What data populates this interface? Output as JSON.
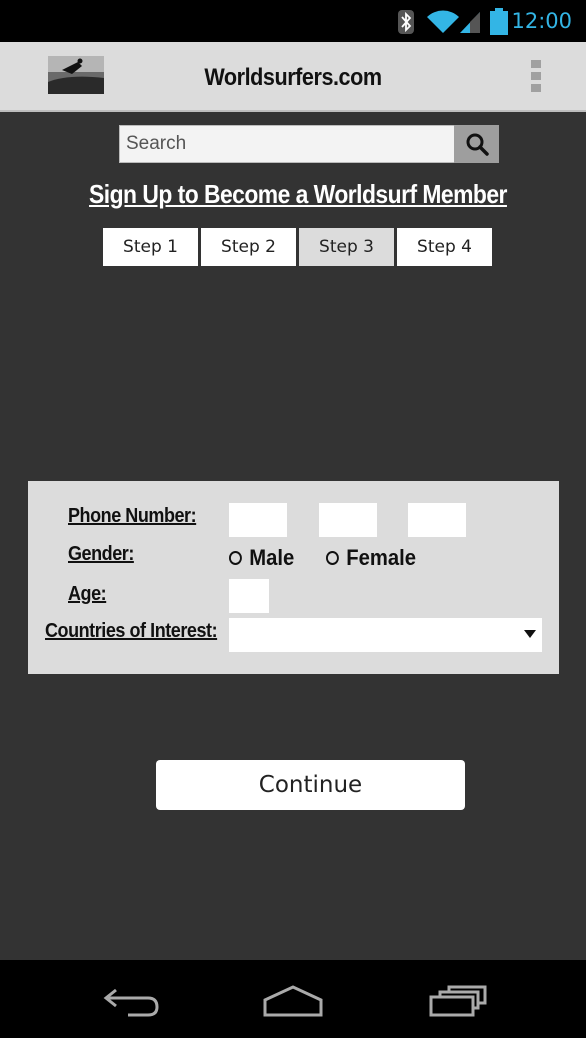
{
  "status_bar": {
    "time": "12:00",
    "icons": [
      "bluetooth-icon",
      "wifi-icon",
      "signal-icon",
      "battery-icon"
    ],
    "accent_color": "#33b5e5"
  },
  "app_bar": {
    "title": "Worldsurfers.com",
    "logo": "surfer-logo",
    "menu_icon": "overflow-menu-icon"
  },
  "search": {
    "placeholder": "Search",
    "value": "",
    "icon": "search-icon"
  },
  "page_title": "Sign Up to Become a Worldsurf Member",
  "steps": [
    {
      "label": "Step 1",
      "active": false
    },
    {
      "label": "Step 2",
      "active": false
    },
    {
      "label": "Step 3",
      "active": true
    },
    {
      "label": "Step 4",
      "active": false
    }
  ],
  "form": {
    "phone_label": "Phone Number:",
    "phone_values": [
      "",
      "",
      ""
    ],
    "gender_label": "Gender:",
    "gender_options": [
      "Male",
      "Female"
    ],
    "age_label": "Age:",
    "age_value": "",
    "countries_label": "Countries of Interest:",
    "countries_value": ""
  },
  "continue_label": "Continue",
  "nav_bar": {
    "icons": [
      "back-icon",
      "home-icon",
      "recent-apps-icon"
    ]
  }
}
